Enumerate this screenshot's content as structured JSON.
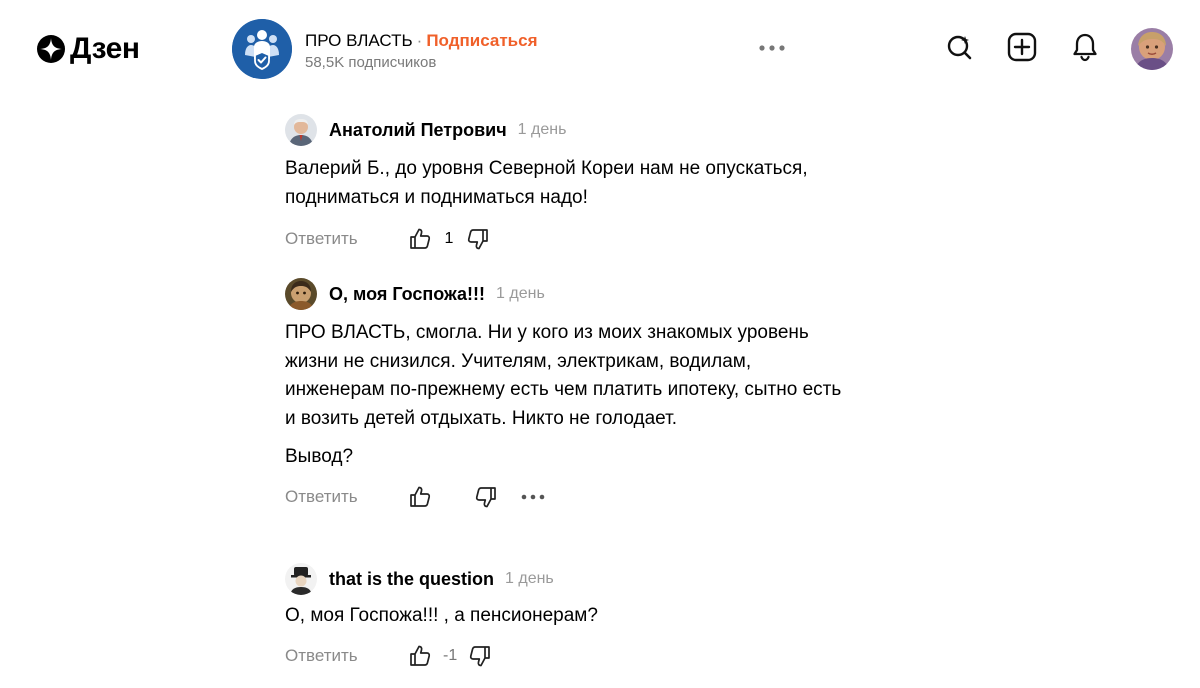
{
  "app": {
    "logo_text": "Дзен"
  },
  "channel": {
    "name": "ПРО ВЛАСТЬ",
    "separator": "·",
    "subscribe_label": "Подписаться",
    "subscribers": "58,5K подписчиков"
  },
  "colors": {
    "accent": "#f0602a",
    "channel_avatar_bg": "#1f5fa8",
    "muted_text": "#8a8a8a"
  },
  "comments": [
    {
      "author": "Анатолий Петрович",
      "time": "1 день",
      "paragraphs": [
        "Валерий Б., до уровня Северной Кореи нам не опускаться, подниматься и подниматься надо!"
      ],
      "reply_label": "Ответить",
      "likes": "1"
    },
    {
      "author": "О, моя Госпожа!!!",
      "time": "1 день",
      "paragraphs": [
        "ПРО ВЛАСТЬ, смогла. Ни у кого из моих знакомых уровень жизни не снизился. Учителям, электрикам, водилам, инженерам по-прежнему есть чем платить ипотеку, сытно есть и возить детей отдыхать. Никто не голодает.",
        "Вывод?"
      ],
      "reply_label": "Ответить",
      "likes": ""
    },
    {
      "author": "that is the question",
      "time": "1 день",
      "paragraphs": [
        "О, моя Госпожа!!! , а пенсионерам?"
      ],
      "reply_label": "Ответить",
      "likes": "-1"
    }
  ]
}
